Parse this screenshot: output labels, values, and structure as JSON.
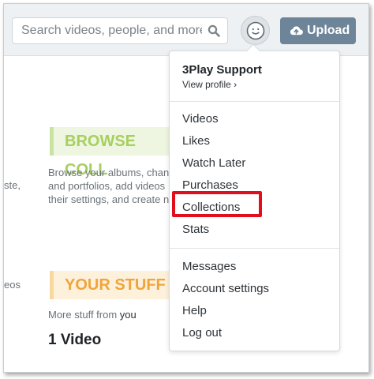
{
  "header": {
    "search_placeholder": "Search videos, people, and more",
    "upload_label": "Upload"
  },
  "background": {
    "browse_heading": "BROWSE COLL",
    "browse_lines": [
      "Browse your albums, chan",
      "and portfolios, add videos",
      "their settings, and create n"
    ],
    "edge_texts": [
      "ste,",
      "eos"
    ],
    "stuff_heading": "YOUR STUFF",
    "more_prefix": "More stuff from ",
    "more_you": "you",
    "video_count": "1 Video"
  },
  "menu": {
    "account_name": "3Play Support",
    "view_profile": "View profile ›",
    "items_main": [
      "Videos",
      "Likes",
      "Watch Later",
      "Purchases",
      "Collections",
      "Stats"
    ],
    "items_account": [
      "Messages",
      "Account settings",
      "Help",
      "Log out"
    ],
    "highlighted": "Collections"
  },
  "colors": {
    "highlight_border": "#e10e1e",
    "upload_bg": "#6d8499",
    "browse_accent": "#a7cf5e",
    "stuff_accent": "#f0a43a"
  },
  "icons": [
    "search-icon",
    "avatar-face-icon",
    "cloud-upload-icon",
    "chevron-right-icon"
  ]
}
